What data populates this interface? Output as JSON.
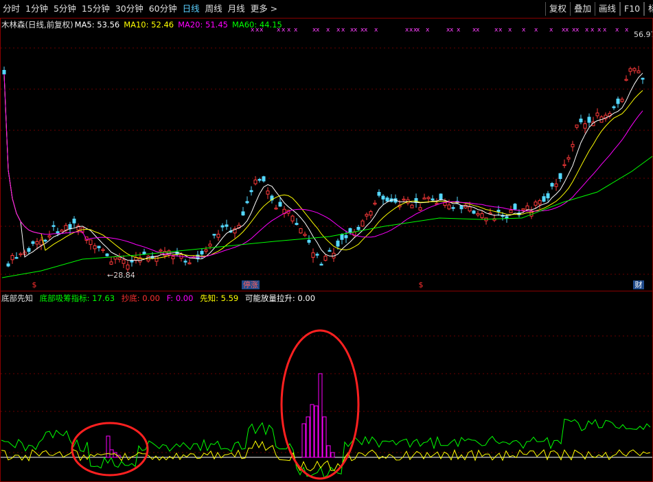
{
  "toolbar": {
    "tabs": [
      "分时",
      "1分钟",
      "5分钟",
      "15分钟",
      "30分钟",
      "60分钟",
      "日线",
      "周线",
      "月线",
      "更多 >"
    ],
    "active_tab": "日线",
    "buttons": [
      "复权",
      "叠加",
      "画线",
      "F10",
      "标"
    ]
  },
  "main_legend": {
    "title": "木林森(日线,前复权)",
    "ma5": "MA5: 53.56",
    "ma10": "MA10: 52.46",
    "ma20": "MA20: 51.45",
    "ma60": "MA60: 44.15",
    "colors": {
      "ma5": "#ffffff",
      "ma10": "#ffff00",
      "ma20": "#ff00ff",
      "ma60": "#00ff00"
    }
  },
  "price_labels": {
    "high": "56.97",
    "low": "←28.84"
  },
  "event_tags": {
    "s1": "$",
    "zhang": "停涨",
    "s2": "$",
    "cai": "财"
  },
  "sub_legend": {
    "title": "底部先知",
    "acc": "底部吸筹指标: 17.63",
    "chaodi": "抄底: 0.00",
    "f": "F: 0.00",
    "xianzhi": "先知: 5.59",
    "fangliang": "可能放量拉升: 0.00",
    "colors": {
      "acc": "#00ff00",
      "chaodi": "#ff3030",
      "f": "#ff00ff",
      "xianzhi": "#ffff00",
      "fangliang": "#ffffff"
    }
  },
  "chart_data": {
    "type": "candlestick",
    "title": "木林森(日线,前复权)",
    "low_marker": 28.84,
    "high_marker": 56.97,
    "moving_averages": {
      "MA5": 53.56,
      "MA10": 52.46,
      "MA20": 51.45,
      "MA60": 44.15
    },
    "indicator": {
      "底部吸筹指标": 17.63,
      "抄底": 0.0,
      "F": 0.0,
      "先知": 5.59,
      "可能放量拉升": 0.0
    }
  }
}
